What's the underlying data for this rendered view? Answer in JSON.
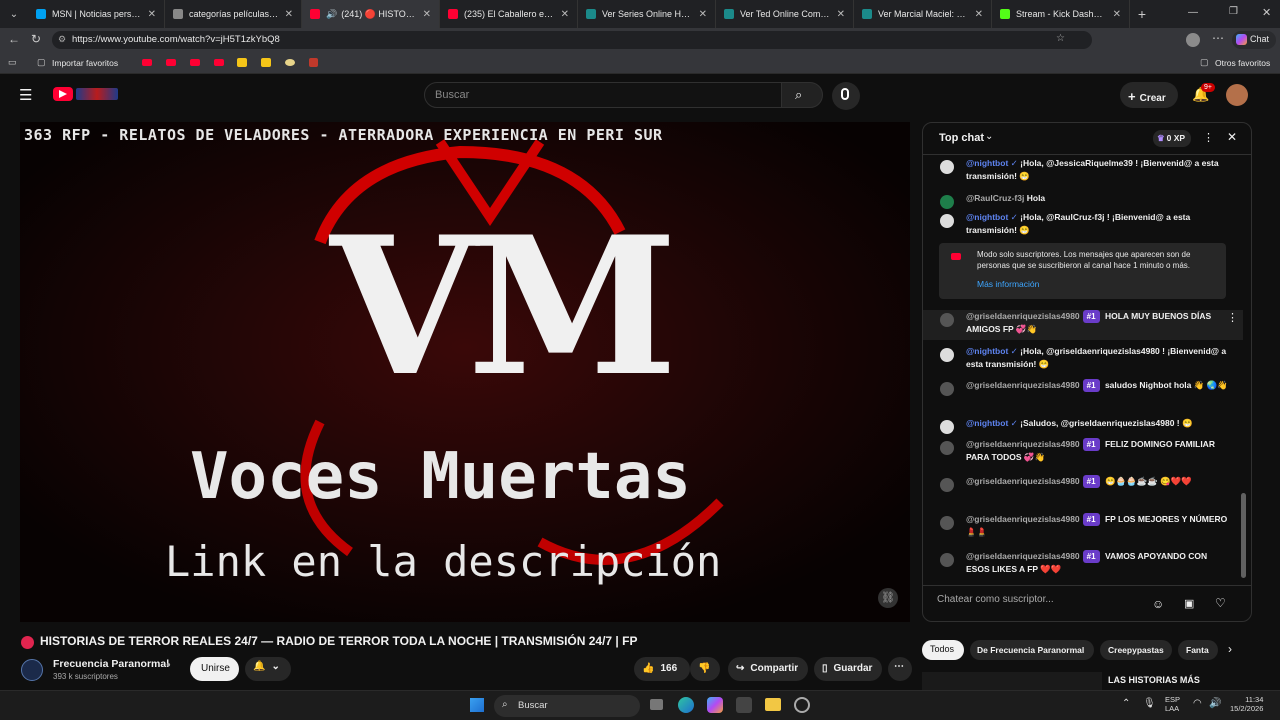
{
  "browser": {
    "tabs": [
      {
        "label": "MSN | Noticias personalizad",
        "color": "#00a1f1"
      },
      {
        "label": "categorías películas | el refu",
        "color": "#888888"
      },
      {
        "label": "(241) 🔴 HISTORIAS DE",
        "color": "#ff0033"
      },
      {
        "label": "(235) El Caballero en un",
        "color": "#ff0033"
      },
      {
        "label": "Ver Series Online HD Gratis",
        "color": "#1b8a8a"
      },
      {
        "label": "Ver Ted Online Completa Gr",
        "color": "#1b8a8a"
      },
      {
        "label": "Ver Marcial Maciel: El Lobo",
        "color": "#1b8a8a"
      },
      {
        "label": "Stream - Kick Dashboard",
        "color": "#53fc18"
      }
    ],
    "url": "https://www.youtube.com/watch?v=jH5T1zkYbQ8",
    "chat_btn": "Chat",
    "bookmarks": {
      "import": "Importar favoritos",
      "other": "Otros favoritos"
    }
  },
  "youtube": {
    "search_placeholder": "Buscar",
    "create_label": "Crear",
    "notif_count": "9+"
  },
  "video": {
    "caption_top": "363 RFP - RELATOS DE VELADORES - ATERRADORA EXPERIENCIA EN PERI SUR",
    "logo_text": "VM",
    "voces": "Voces Muertas",
    "link_desc": "Link en la descripción",
    "title": "HISTORIAS DE TERROR REALES 24/7 — RADIO DE TERROR TODA LA NOCHE | TRANSMISIÓN 24/7 | FP",
    "channel": "Frecuencia Paranormal",
    "subscribers": "393 k suscriptores",
    "join_label": "Unirse",
    "likes": "166",
    "share_label": "Compartir",
    "save_label": "Guardar"
  },
  "chat": {
    "title": "Top chat",
    "xp": "0 XP",
    "messages": [
      {
        "author": "@nightbot",
        "text": "¡Hola, @JessicaRiquelme39 ! ¡Bienvenid@ a esta transmisión! 😁"
      },
      {
        "author": "@RaulCruz-f3j",
        "text": "Hola"
      },
      {
        "author": "@nightbot",
        "text": "¡Hola, @RaulCruz-f3j ! ¡Bienvenid@ a esta transmisión! 😁"
      },
      {
        "author": "@griseldaenriquezislas4980",
        "badge": "#1",
        "text": "HOLA MUY BUENOS DÍAS AMIGOS FP 💞👋"
      },
      {
        "author": "@nightbot",
        "text": "¡Hola, @griseldaenriquezislas4980 ! ¡Bienvenid@ a esta transmisión! 😁"
      },
      {
        "author": "@griseldaenriquezislas4980",
        "badge": "#1",
        "text": "saludos Nighbot hola 👋 🌏👋"
      },
      {
        "author": "@nightbot",
        "text": "¡Saludos, @griseldaenriquezislas4980 ! 😁"
      },
      {
        "author": "@griseldaenriquezislas4980",
        "badge": "#1",
        "text": "FELIZ DOMINGO FAMILIAR PARA TODOS 💞👋"
      },
      {
        "author": "@griseldaenriquezislas4980",
        "badge": "#1",
        "text": "😁🧁🧁☕☕ 😋❤️❤️"
      },
      {
        "author": "@griseldaenriquezislas4980",
        "badge": "#1",
        "text": "FP LOS MEJORES Y NÚMERO 💄💄"
      },
      {
        "author": "@griseldaenriquezislas4980",
        "badge": "#1",
        "text": "VAMOS APOYANDO CON ESOS LIKES A FP ❤️❤️"
      }
    ],
    "notice": {
      "text": "Modo solo suscriptores. Los mensajes que aparecen son de personas que se suscribieron al canal hace 1 minuto o más.",
      "link": "Más información"
    },
    "input_placeholder": "Chatear como suscriptor...",
    "tabs": [
      "Todos",
      "De Frecuencia Paranormal",
      "Creepypastas",
      "Fanta"
    ],
    "up_next": "LAS HISTORIAS MÁS"
  },
  "taskbar": {
    "search": "Buscar",
    "lang": "ESP",
    "layout": "LAA",
    "time": "11:34",
    "date": "15/2/2026"
  }
}
